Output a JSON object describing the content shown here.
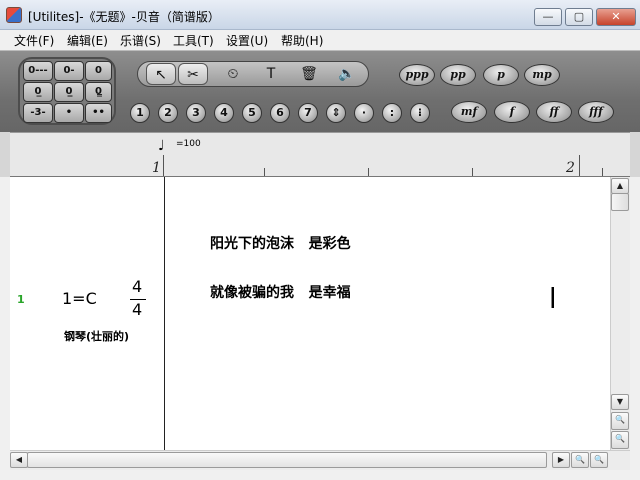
{
  "window": {
    "title": "[Utilites]-《无题》-贝音（简谱版）",
    "min_glyph": "—",
    "max_glyph": "▢",
    "close_glyph": "✕"
  },
  "menu": [
    "文件(F)",
    "编辑(E)",
    "乐谱(S)",
    "工具(T)",
    "设置(U)",
    "帮助(H)"
  ],
  "toolbar": {
    "keypad": [
      "0---",
      "0-",
      "0",
      "0̲",
      "0̲̲",
      "0̳",
      "-3-",
      "•",
      "••"
    ],
    "tools": [
      {
        "name": "select-arrow-icon",
        "glyph": "↖"
      },
      {
        "name": "scissors-icon",
        "glyph": "✂"
      },
      {
        "name": "metronome-icon",
        "glyph": "⏲"
      },
      {
        "name": "text-tool-icon",
        "glyph": "T"
      },
      {
        "name": "trash-icon",
        "glyph": "🗑"
      },
      {
        "name": "speaker-icon",
        "glyph": "🔈"
      }
    ],
    "numbers": [
      "1",
      "2",
      "3",
      "4",
      "5",
      "6",
      "7",
      "⇕",
      "·",
      ":",
      "⁝"
    ],
    "dynamics_top": [
      "ppp",
      "pp",
      "p",
      "mp"
    ],
    "dynamics_bottom": [
      "mf",
      "f",
      "ff",
      "fff"
    ]
  },
  "ruler": {
    "tempo_note": "♩",
    "tempo": "=100",
    "measure1": "1",
    "measure2": "2"
  },
  "score": {
    "staff_number": "1",
    "key": "1=C",
    "time_top": "4",
    "time_bottom": "4",
    "instrument": "钢琴(壮丽的)",
    "lyric_line1": "阳光下的泡沫   是彩色",
    "lyric_line2": "就像被骗的我   是幸福"
  },
  "scroll": {
    "up": "▲",
    "down": "▼",
    "left": "◀",
    "right": "▶",
    "zoom_in": "🔍",
    "zoom_out": "🔍"
  }
}
